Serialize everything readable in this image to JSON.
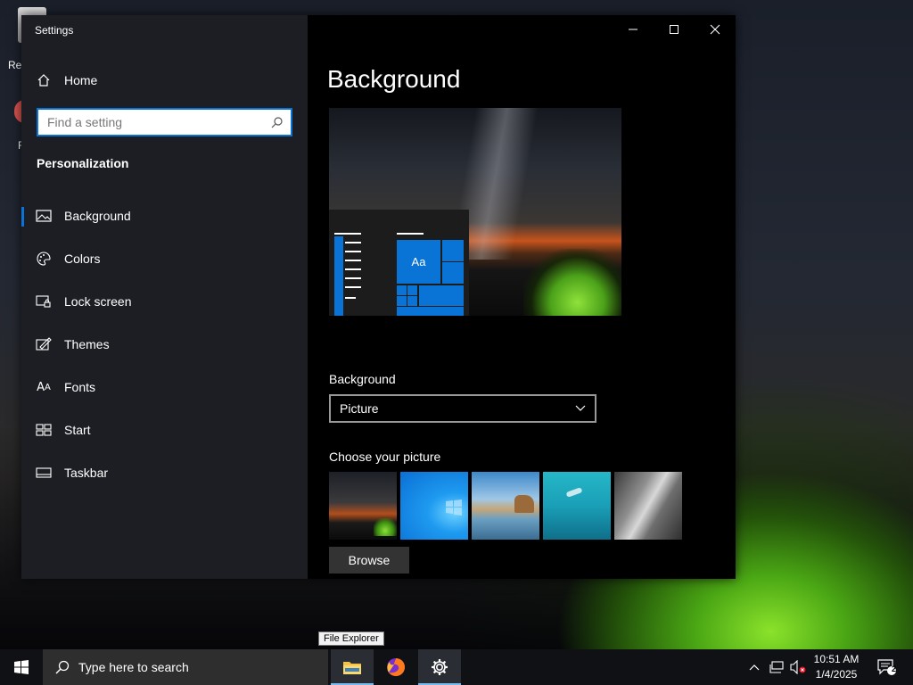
{
  "desktop": {
    "icon_label": "Rec",
    "icon2_label": "F"
  },
  "window": {
    "title": "Settings",
    "controls": {
      "minimize_icon": "minimize-icon",
      "maximize_icon": "maximize-icon",
      "close_icon": "close-icon"
    }
  },
  "sidebar": {
    "home_label": "Home",
    "search_placeholder": "Find a setting",
    "section_title": "Personalization",
    "items": [
      {
        "label": "Background",
        "icon": "image-icon",
        "active": true
      },
      {
        "label": "Colors",
        "icon": "palette-icon",
        "active": false
      },
      {
        "label": "Lock screen",
        "icon": "lock-screen-icon",
        "active": false
      },
      {
        "label": "Themes",
        "icon": "themes-icon",
        "active": false
      },
      {
        "label": "Fonts",
        "icon": "fonts-icon",
        "active": false
      },
      {
        "label": "Start",
        "icon": "start-icon",
        "active": false
      },
      {
        "label": "Taskbar",
        "icon": "taskbar-icon",
        "active": false
      }
    ]
  },
  "main": {
    "title": "Background",
    "preview": {
      "tile_label": "Aa"
    },
    "background_label": "Background",
    "background_value": "Picture",
    "choose_label": "Choose your picture",
    "thumbnails": [
      {
        "name": "night-sky-tent"
      },
      {
        "name": "windows-blue"
      },
      {
        "name": "beach-rocks"
      },
      {
        "name": "underwater-swimmer"
      },
      {
        "name": "rock-cliff"
      }
    ],
    "browse_label": "Browse"
  },
  "tooltip": "File Explorer",
  "taskbar": {
    "search_placeholder": "Type here to search",
    "apps": [
      {
        "name": "File Explorer",
        "icon": "folder-icon",
        "running": true
      },
      {
        "name": "Firefox",
        "icon": "firefox-icon",
        "running": false
      },
      {
        "name": "Settings",
        "icon": "gear-icon",
        "running": true
      }
    ],
    "time": "10:51 AM",
    "date": "1/4/2025",
    "notification_count": "2"
  },
  "colors": {
    "accent": "#0a74d6",
    "tile_blue": "#0a74d6"
  }
}
